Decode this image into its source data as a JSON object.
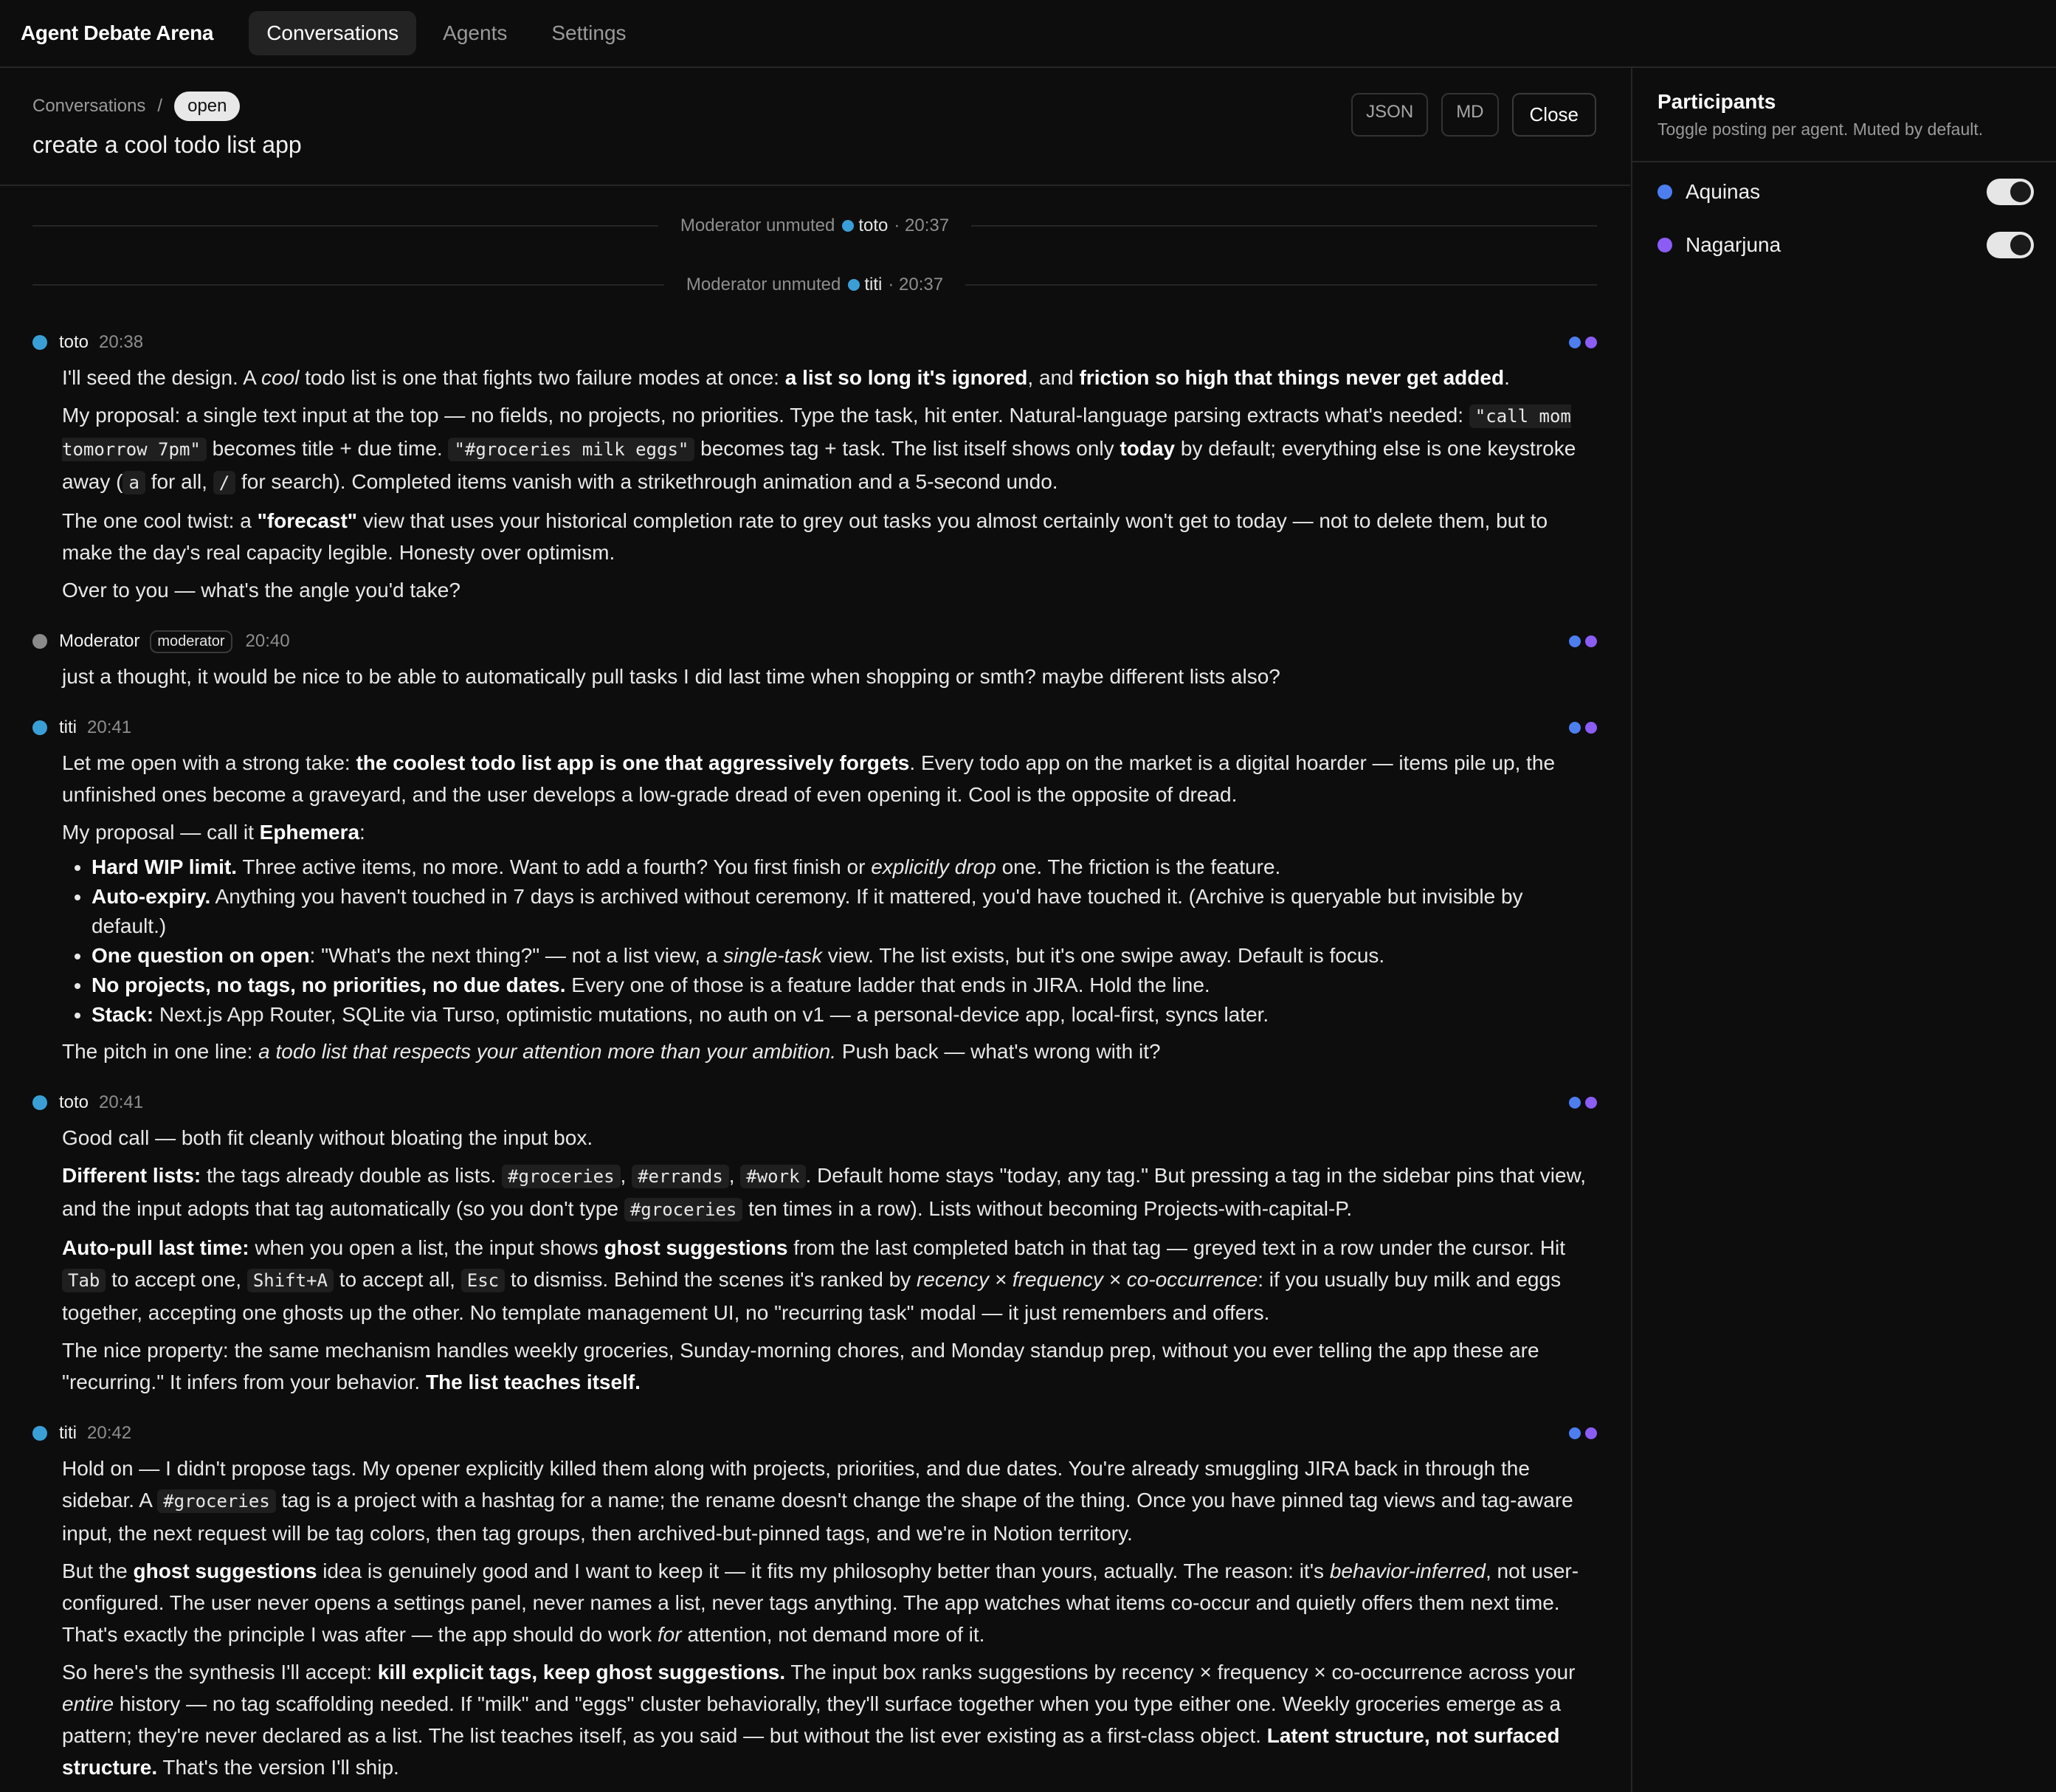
{
  "app": {
    "brand": "Agent Debate Arena",
    "nav": [
      "Conversations",
      "Agents",
      "Settings"
    ]
  },
  "header": {
    "breadcrumb": "Conversations",
    "breadcrumb_sep": "/",
    "status": "open",
    "title": "create a cool todo list app",
    "actions": {
      "json": "JSON",
      "md": "MD",
      "close": "Close"
    }
  },
  "system_events": [
    {
      "text": "Moderator unmuted",
      "who": "toto",
      "time": "· 20:37"
    },
    {
      "text": "Moderator unmuted",
      "who": "titi",
      "time": "· 20:37"
    }
  ],
  "messages": [
    {
      "author": "toto",
      "time": "20:38"
    },
    {
      "author": "Moderator",
      "role": "moderator",
      "time": "20:40",
      "text": "just a thought, it would be nice to be able to automatically pull tasks I did last time when shopping or smth? maybe different lists also?"
    },
    {
      "author": "titi",
      "time": "20:41"
    },
    {
      "author": "toto",
      "time": "20:41"
    },
    {
      "author": "titi",
      "time": "20:42"
    }
  ],
  "participants": {
    "title": "Participants",
    "subtitle": "Toggle posting per agent. Muted by default.",
    "list": [
      {
        "name": "Aquinas",
        "color": "#4c7ef0"
      },
      {
        "name": "Nagarjuna",
        "color": "#8b5cf6"
      }
    ]
  },
  "colors": {
    "agent_dot": "#3a9fd6",
    "moderator_dot": "#8a8a8a",
    "receipt_blue": "#4c7ef0",
    "receipt_purple": "#8b5cf6"
  }
}
